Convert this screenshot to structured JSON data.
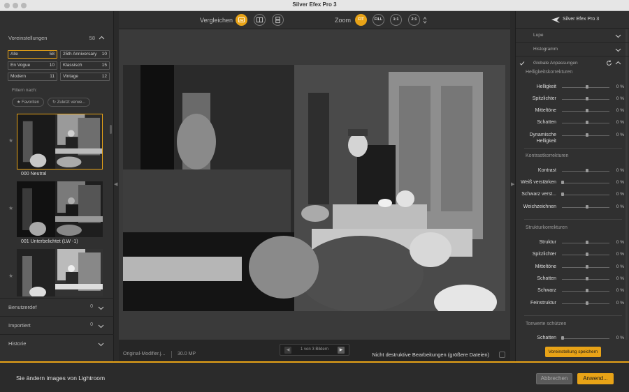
{
  "window": {
    "title": "Silver Efex Pro 3"
  },
  "colors": {
    "accent": "#e8a317",
    "panel": "#303030",
    "background": "#262626"
  },
  "left": {
    "presets_header": {
      "label": "Voreinstellungen",
      "count": "58"
    },
    "presets": [
      {
        "label": "Alle",
        "count": "58",
        "active": true
      },
      {
        "label": "25th Anniversary",
        "count": "10"
      },
      {
        "label": "En Vogue",
        "count": "10"
      },
      {
        "label": "Klassisch",
        "count": "15"
      },
      {
        "label": "Modern",
        "count": "11"
      },
      {
        "label": "Vintage",
        "count": "12"
      }
    ],
    "filter_label": "Filtern nach:",
    "chips": [
      {
        "label": "★ Favoriten"
      },
      {
        "label": "↻ Zuletzt verwe..."
      }
    ],
    "thumbnails": [
      {
        "label": "000 Neutral",
        "selected": true
      },
      {
        "label": "001 Unterbelichtet (LW -1)"
      },
      {
        "label": ""
      }
    ],
    "collapsed_sections": [
      {
        "label": "Benutzerdef",
        "count": "0"
      },
      {
        "label": "Importiert",
        "count": "0"
      },
      {
        "label": "Historie",
        "count": ""
      }
    ]
  },
  "center": {
    "compare_label": "Vergleichen",
    "zoom_label": "Zoom",
    "zoom_options": [
      {
        "label": "FIT",
        "active": true
      },
      {
        "label": "FILL"
      },
      {
        "label": "1:1"
      },
      {
        "label": "2:1"
      }
    ],
    "pager": {
      "text": "1 von 3 Bildern"
    },
    "info": {
      "filename": "Original-Modifier.j...",
      "megapixels": "30.0 MP",
      "nondestructive": "Nicht destruktive Bearbeitungen (größere Dateien)"
    }
  },
  "right": {
    "product_name": "Silver Efex Pro 3",
    "rows": [
      {
        "label": "Lupe"
      },
      {
        "label": "Histogramm"
      }
    ],
    "global_adjust": "Globale Anpassungen",
    "groups": [
      {
        "title": "Helligkeitskorrekturen",
        "sliders": [
          {
            "label": "Helligkeit",
            "value": "0 %"
          },
          {
            "label": "Spitzlichter",
            "value": "0 %"
          },
          {
            "label": "Mitteltöne",
            "value": "0 %"
          },
          {
            "label": "Schatten",
            "value": "0 %"
          },
          {
            "label": "Dynamische Helligkeit",
            "value": "0 %"
          }
        ]
      },
      {
        "title": "Kontrastkorrekturen",
        "sliders": [
          {
            "label": "Kontrast",
            "value": "0 %"
          },
          {
            "label": "Weiß verstärken",
            "value": "0 %"
          },
          {
            "label": "Schwarz verst...",
            "value": "0 %"
          },
          {
            "label": "Weichzeichnen",
            "value": "0 %"
          }
        ]
      },
      {
        "title": "Strukturkorrekturen",
        "sliders": [
          {
            "label": "Struktur",
            "value": "0 %"
          },
          {
            "label": "Spitzlichter",
            "value": "0 %"
          },
          {
            "label": "Mitteltöne",
            "value": "0 %"
          },
          {
            "label": "Schatten",
            "value": "0 %"
          },
          {
            "label": "Schwarz",
            "value": "0 %"
          },
          {
            "label": "Feinstruktur",
            "value": "0 %"
          }
        ]
      },
      {
        "title": "Tonwerte schützen",
        "sliders": [
          {
            "label": "Schatten",
            "value": "0 %"
          }
        ]
      }
    ],
    "save_preset": "Voreinstellung speichern"
  },
  "footer": {
    "message": "Sie ändern images von Lightroom",
    "cancel": "Abbrechen",
    "apply": "Anwend..."
  }
}
